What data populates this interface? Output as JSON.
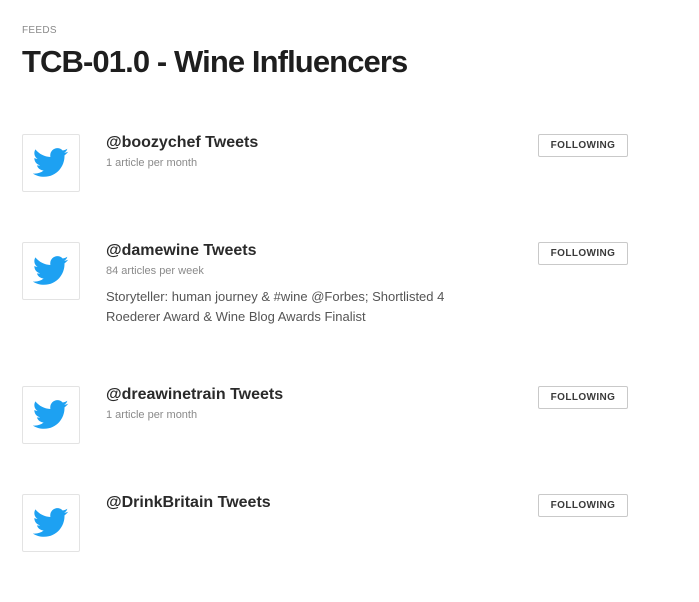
{
  "header": {
    "breadcrumb": "FEEDS",
    "title": "TCB-01.0 - Wine Influencers"
  },
  "colors": {
    "twitter_blue": "#1da1f2",
    "title_text": "#1e1e1e",
    "muted_text": "#8a8a8a",
    "border": "#e3e3e3"
  },
  "feeds": [
    {
      "icon": "twitter-bird-icon",
      "title": "@boozychef Tweets",
      "frequency": "1 article per month",
      "description": "",
      "button_label": "FOLLOWING"
    },
    {
      "icon": "twitter-bird-icon",
      "title": "@damewine Tweets",
      "frequency": "84 articles per week",
      "description": "Storyteller: human journey & #wine @Forbes; Shortlisted 4 Roederer Award & Wine Blog Awards Finalist",
      "button_label": "FOLLOWING"
    },
    {
      "icon": "twitter-bird-icon",
      "title": "@dreawinetrain Tweets",
      "frequency": "1 article per month",
      "description": "",
      "button_label": "FOLLOWING"
    },
    {
      "icon": "twitter-bird-icon",
      "title": "@DrinkBritain Tweets",
      "frequency": "",
      "description": "",
      "button_label": "FOLLOWING"
    }
  ]
}
